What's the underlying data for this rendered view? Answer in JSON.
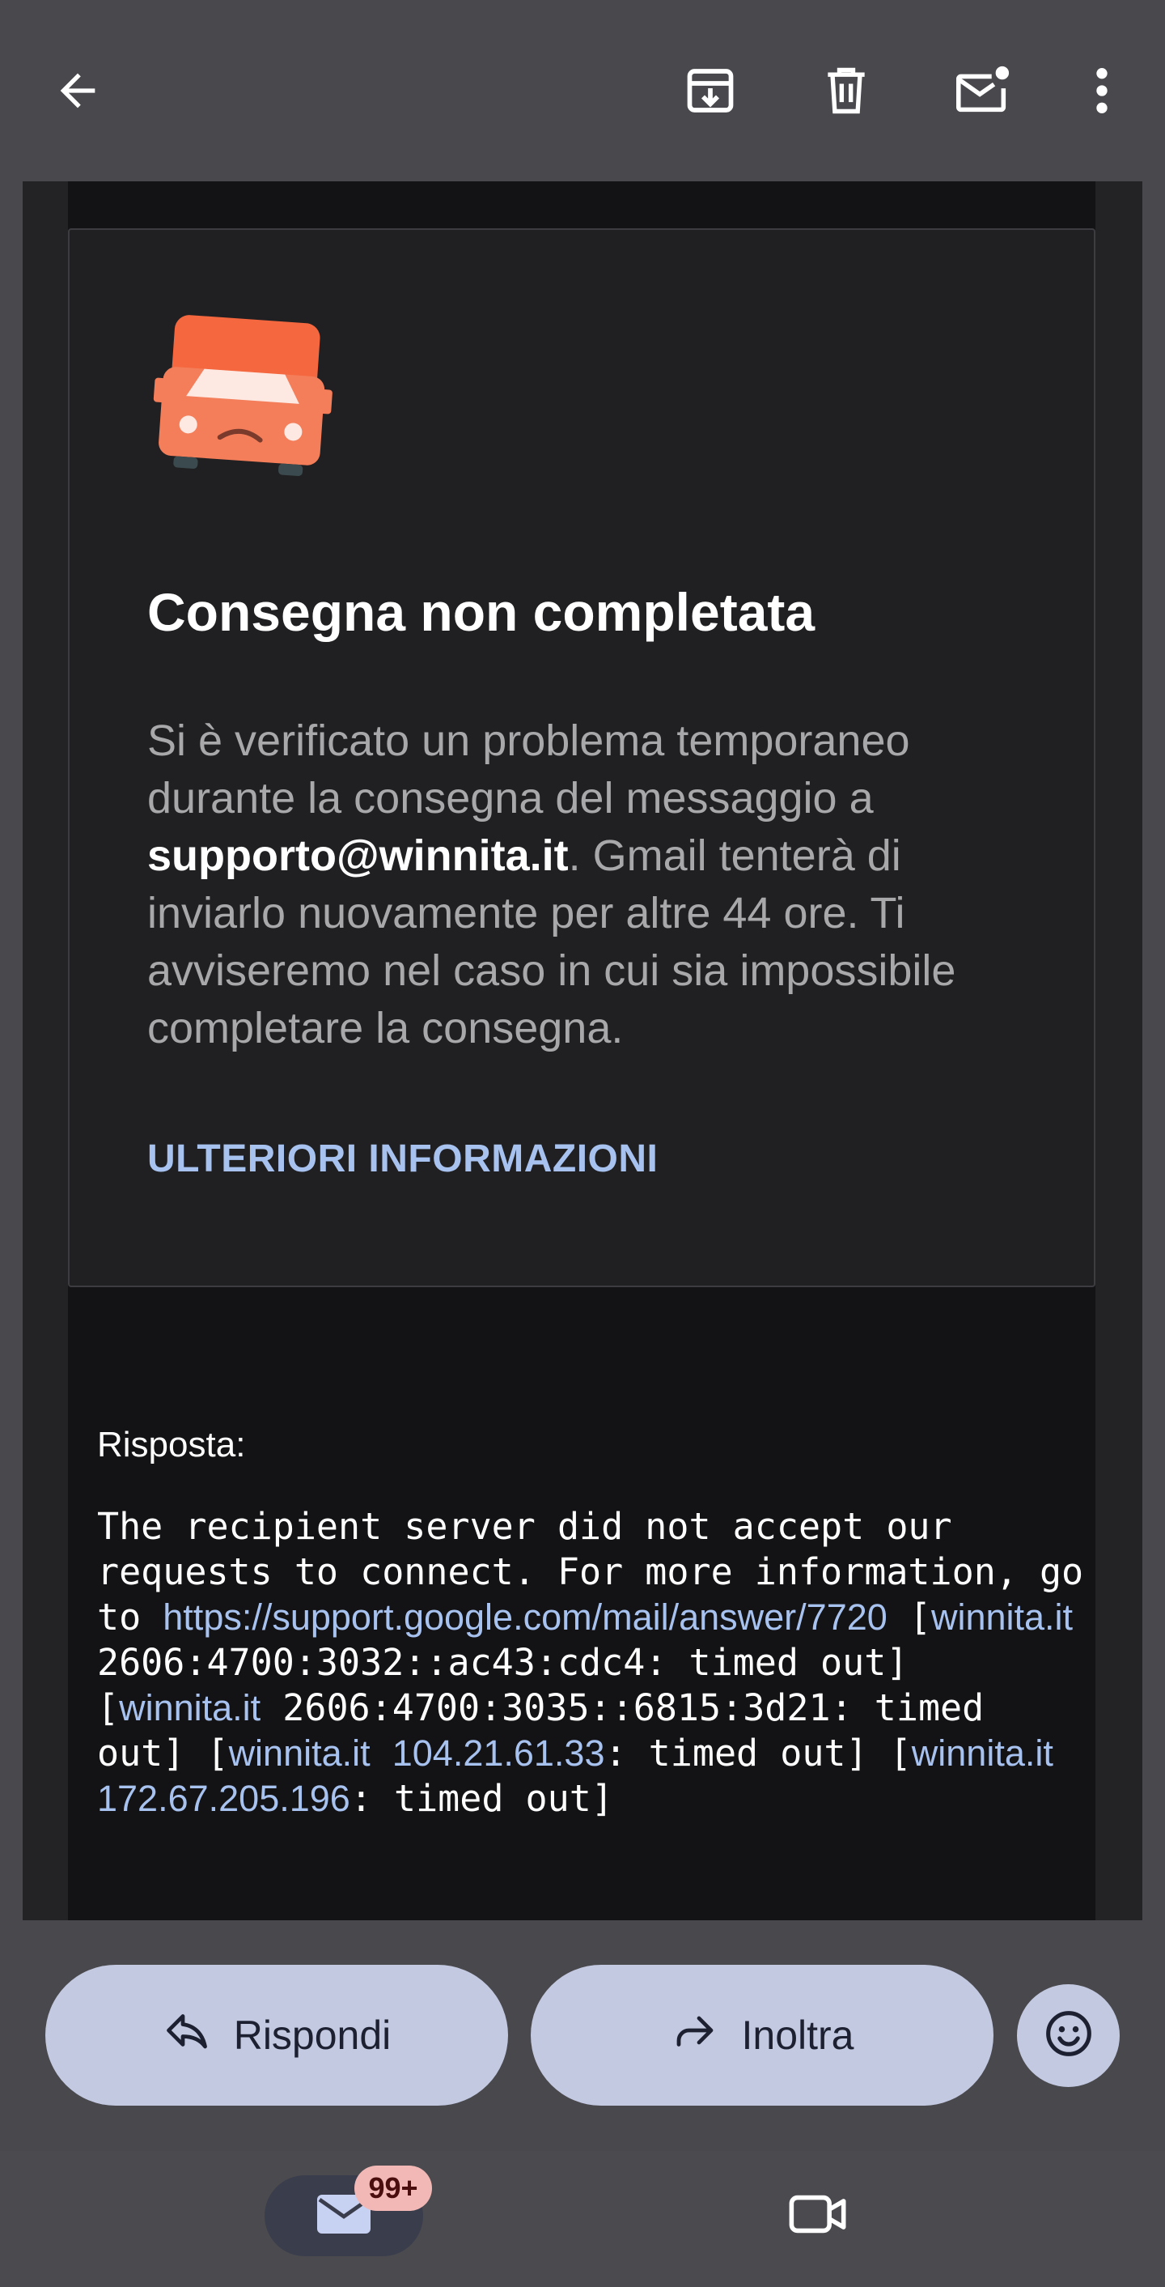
{
  "card": {
    "title": "Consegna non completata",
    "text_before": "Si è verificato un problema temporaneo durante la consegna del messaggio a ",
    "recipient": "supporto@winnita.it",
    "text_after": ". Gmail tenterà di inviarlo nuovamente per altre 44 ore. Ti avviseremo nel caso in cui sia impossibile completare la consegna.",
    "more_link": "ULTERIORI INFORMAZIONI"
  },
  "reply": {
    "label": "Risposta:",
    "text_1": "The recipient server did not accept our requests to connect. For more information, go to ",
    "link_1": "https://support.google.com/mail/answer/7720",
    "text_2": " [",
    "domain_1": "winnita.it",
    "text_3": " 2606:4700:3032::ac43:cdc4: timed out] [",
    "domain_2": "winnita.it",
    "text_4": " 2606:4700:3035::6815:3d21: timed out] [",
    "domain_3": "winnita.it",
    "text_5": " ",
    "ip_1": "104.21.61.33",
    "text_6": ": timed out] [",
    "domain_4": "winnita.it",
    "text_7": " ",
    "ip_2": "172.67.205.196",
    "text_8": ": timed out]"
  },
  "actions": {
    "reply_label": "Rispondi",
    "forward_label": "Inoltra"
  },
  "bottom_nav": {
    "mail_badge": "99+"
  },
  "icons": {
    "toolbar": [
      "back-arrow-icon",
      "archive-icon",
      "trash-icon",
      "mark-unread-icon",
      "more-vert-icon"
    ],
    "card": "delivery-truck-sad-icon",
    "actions": [
      "reply-icon",
      "forward-icon",
      "emoji-icon"
    ],
    "nav": [
      "mail-icon",
      "video-camera-icon"
    ]
  },
  "colors": {
    "background": "#48484d",
    "card": "#202022",
    "link": "#a8c2f0",
    "button": "#c3c9e1",
    "badge": "#f1b8b5",
    "truck": "#f4673f"
  }
}
